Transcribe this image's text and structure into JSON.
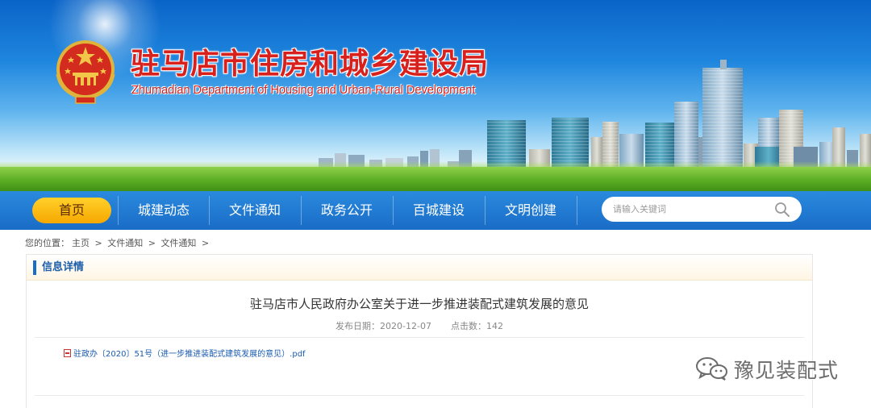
{
  "header": {
    "title_cn": "驻马店市住房和城乡建设局",
    "title_en": "Zhumadian Department of Housing and Urban-Rural Development",
    "emblem_icon": "national-emblem-icon"
  },
  "nav": {
    "home": "首页",
    "items": [
      "城建动态",
      "文件通知",
      "政务公开",
      "百城建设",
      "文明创建"
    ],
    "search_placeholder": "请输入关键词",
    "active_color": "#f6a800",
    "bar_color": "#1a6cc6"
  },
  "breadcrumb": {
    "prefix": "您的位置：",
    "items": [
      "主页",
      "文件通知",
      "文件通知"
    ],
    "separator": ">"
  },
  "panel": {
    "heading": "信息详情",
    "article_title": "驻马店市人民政府办公室关于进一步推进装配式建筑发展的意见",
    "publish_label": "发布日期：",
    "publish_date": "2020-12-07",
    "clicks_label": "点击数：",
    "clicks": "142",
    "attachment": "驻政办〔2020〕51号（进一步推进装配式建筑发展的意见）.pdf"
  },
  "watermark": {
    "text": "豫见装配式",
    "icon": "wechat-icon"
  }
}
